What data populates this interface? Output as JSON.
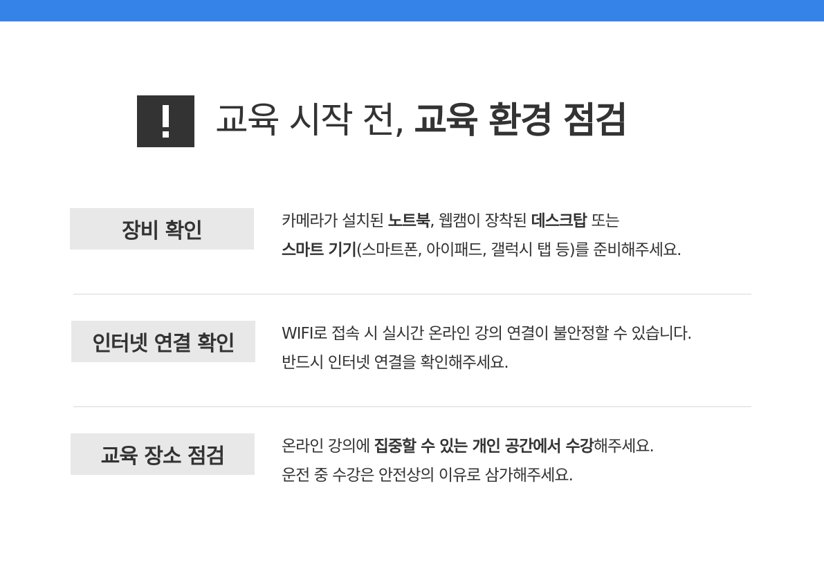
{
  "title": {
    "light": "교육 시작 전,",
    "bold": "교육 환경 점검"
  },
  "sections": [
    {
      "label": "장비 확인",
      "line1": [
        "카메라가 설치된 ",
        "노트북",
        ", 웹캠이 장착된 ",
        "데스크탑",
        " 또는"
      ],
      "line2": [
        "스마트 기기",
        "(스마트폰, 아이패드, 갤럭시 탭 등)를 준비해주세요."
      ]
    },
    {
      "label": "인터넷 연결 확인",
      "line1": [
        "WIFI로 접속 시 실시간 온라인 강의 연결이 불안정할 수 있습니다."
      ],
      "line2": [
        "반드시 인터넷 연결을 확인해주세요."
      ]
    },
    {
      "label": "교육 장소 점검",
      "line1": [
        "온라인 강의에 ",
        "집중할 수 있는 개인 공간에서 수강",
        "해주세요."
      ],
      "line2": [
        "운전 중 수강은 안전상의 이유로 삼가해주세요."
      ]
    }
  ],
  "colors": {
    "top_bar": "#3583e8",
    "text": "#333333",
    "label_bg": "#e8e8e8"
  },
  "icons": {
    "alert": "exclamation-icon"
  }
}
